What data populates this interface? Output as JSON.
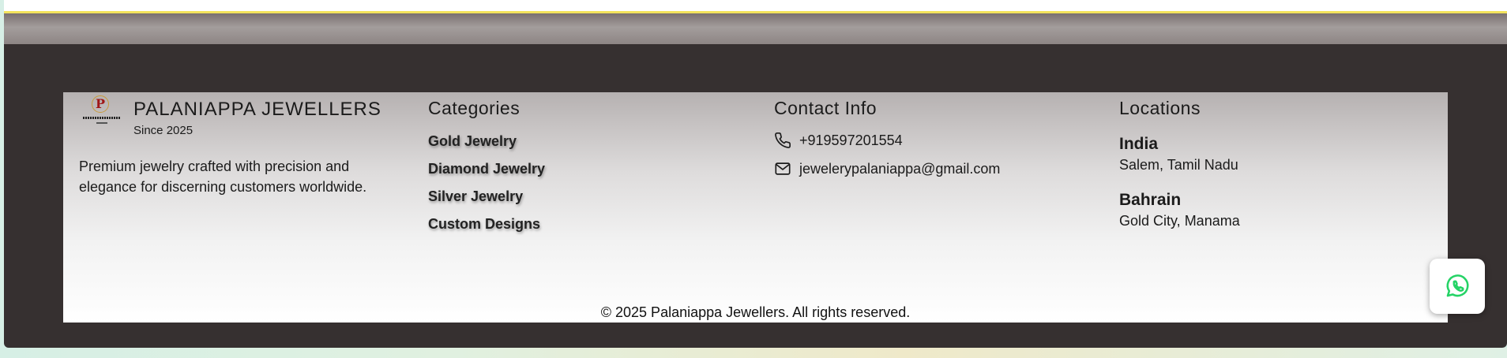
{
  "brand": {
    "name": "PALANIAPPA JEWELLERS",
    "since": "Since 2025",
    "logo_letter": "P",
    "description": "Premium jewelry crafted with precision and elegance for discerning customers worldwide."
  },
  "categories": {
    "heading": "Categories",
    "items": [
      "Gold Jewelry",
      "Diamond Jewelry",
      "Silver Jewelry",
      "Custom Designs"
    ]
  },
  "contact": {
    "heading": "Contact Info",
    "phone": "+919597201554",
    "email": "jewelerypalaniappa@gmail.com",
    "phone_icon": "phone-icon",
    "email_icon": "mail-icon"
  },
  "locations": {
    "heading": "Locations",
    "items": [
      {
        "country": "India",
        "city": "Salem, Tamil Nadu"
      },
      {
        "country": "Bahrain",
        "city": "Gold City, Manama"
      }
    ]
  },
  "copyright": "© 2025 Palaniappa Jewellers. All rights reserved.",
  "whatsapp": {
    "icon": "whatsapp-icon",
    "color": "#25d366"
  },
  "colors": {
    "footer_frame": "#363030",
    "accent_border": "#f3e35c"
  }
}
